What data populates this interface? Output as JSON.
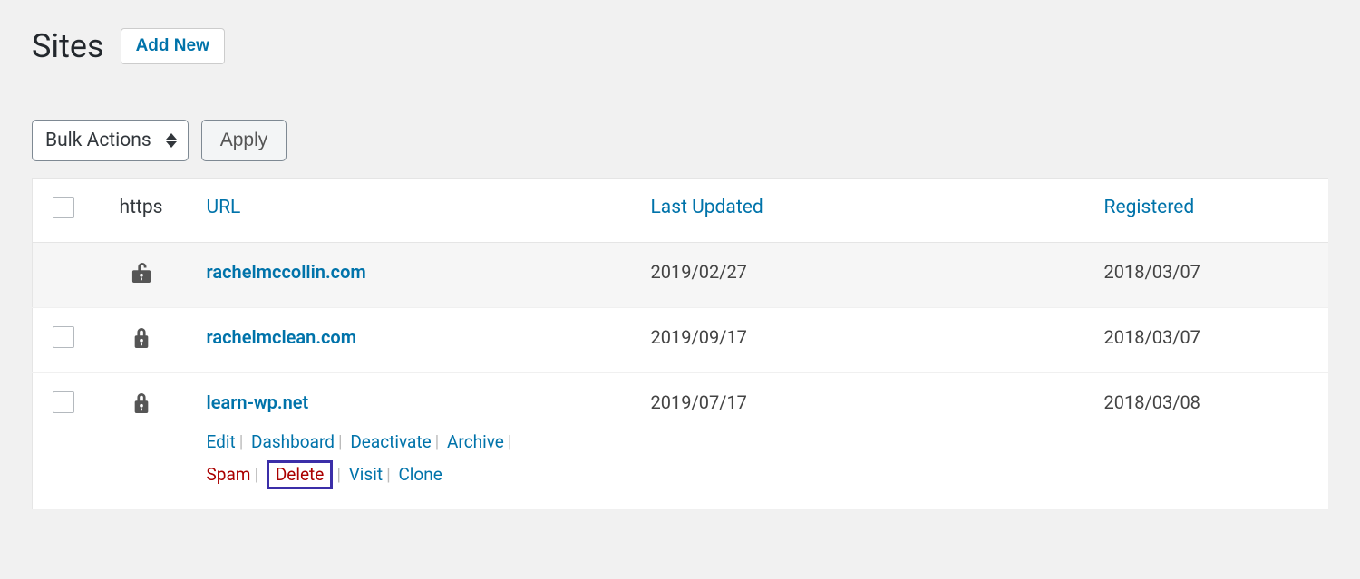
{
  "page_title": "Sites",
  "add_new_label": "Add New",
  "bulk_actions_label": "Bulk Actions",
  "apply_label": "Apply",
  "columns": {
    "https": "https",
    "url": "URL",
    "last_updated": "Last Updated",
    "registered": "Registered"
  },
  "rows": [
    {
      "locked": false,
      "url": "rachelmccollin.com",
      "last_updated": "2019/02/27",
      "registered": "2018/03/07"
    },
    {
      "locked": true,
      "url": "rachelmclean.com",
      "last_updated": "2019/09/17",
      "registered": "2018/03/07"
    },
    {
      "locked": true,
      "url": "learn-wp.net",
      "last_updated": "2019/07/17",
      "registered": "2018/03/08"
    }
  ],
  "row_actions": {
    "edit": "Edit",
    "dashboard": "Dashboard",
    "deactivate": "Deactivate",
    "archive": "Archive",
    "spam": "Spam",
    "delete": "Delete",
    "visit": "Visit",
    "clone": "Clone"
  }
}
